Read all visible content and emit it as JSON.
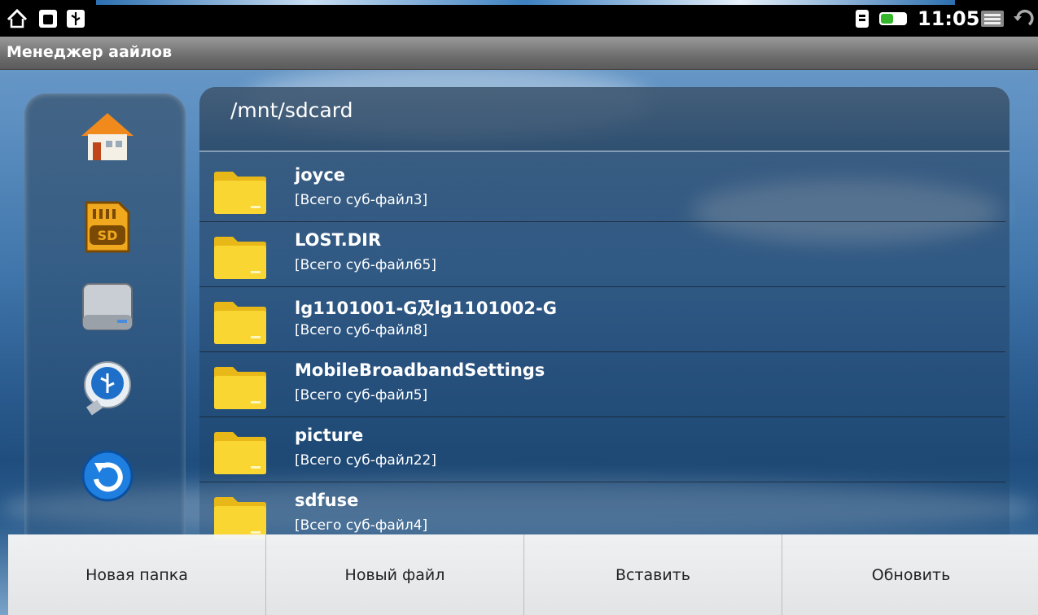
{
  "status_bar": {
    "time": "11:05",
    "icons": [
      "home-icon",
      "android-debug-icon",
      "usb-icon",
      "sim-card-icon",
      "battery-icon",
      "menu-icon",
      "back-icon"
    ]
  },
  "title_bar": {
    "title": "Менеджер аайлов"
  },
  "sidebar": {
    "items": [
      {
        "icon": "home-icon"
      },
      {
        "icon": "sd-card-icon"
      },
      {
        "icon": "hard-drive-icon"
      },
      {
        "icon": "usb-drive-icon"
      },
      {
        "icon": "back-arrow-icon"
      }
    ]
  },
  "path": "/mnt/sdcard",
  "files": [
    {
      "name": "joyce",
      "sub": "[Всего суб-файл3]"
    },
    {
      "name": "LOST.DIR",
      "sub": "[Всего суб-файл65]"
    },
    {
      "name": "lg1101001-G及lg1101002-G",
      "sub": "[Всего суб-файл8]"
    },
    {
      "name": "MobileBroadbandSettings",
      "sub": "[Всего суб-файл5]"
    },
    {
      "name": "picture",
      "sub": "[Всего суб-файл22]"
    },
    {
      "name": "sdfuse",
      "sub": "[Всего суб-файл4]"
    }
  ],
  "menu": {
    "new_folder": "Новая папка",
    "new_file": "Новый файл",
    "paste": "Вставить",
    "refresh": "Обновить"
  },
  "colors": {
    "folder": "#f7d22e",
    "menu_bg": "#f0f0f0",
    "status_bar": "#000000"
  }
}
